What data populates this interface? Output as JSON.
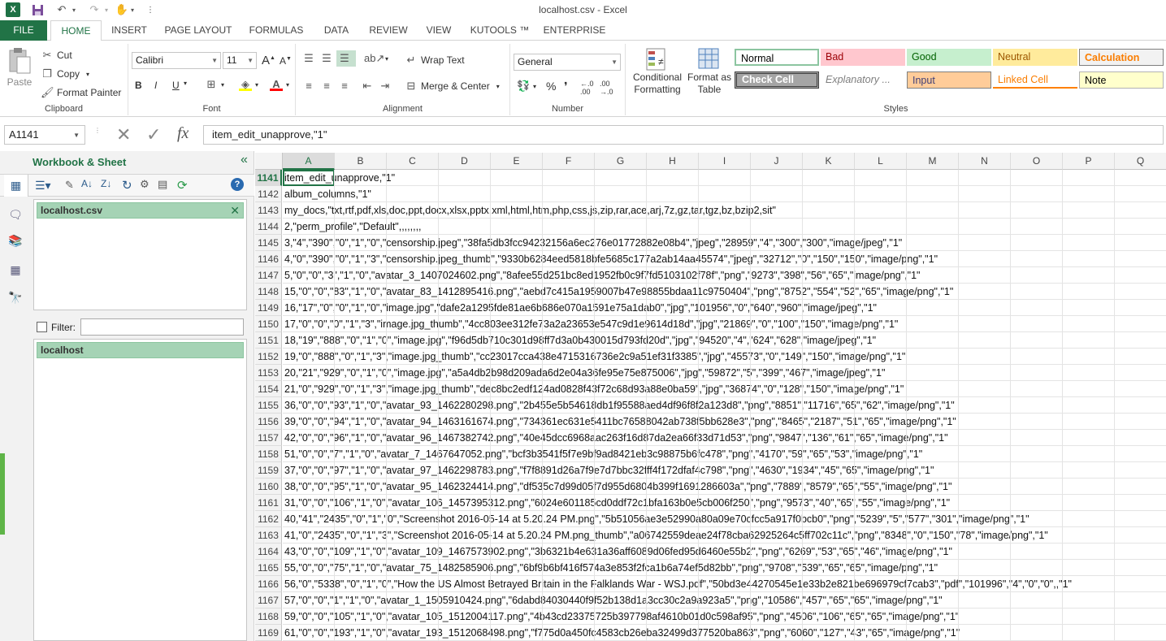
{
  "app": {
    "title": "localhost.csv - Excel",
    "logo": "X"
  },
  "tabs": [
    "FILE",
    "HOME",
    "INSERT",
    "PAGE LAYOUT",
    "FORMULAS",
    "DATA",
    "REVIEW",
    "VIEW",
    "KUTOOLS ™",
    "ENTERPRISE"
  ],
  "ribbon": {
    "clipboard": {
      "label": "Clipboard",
      "paste": "Paste",
      "cut": "Cut",
      "copy": "Copy",
      "format_painter": "Format Painter"
    },
    "font": {
      "label": "Font",
      "name": "Calibri",
      "size": "11",
      "bold": "B",
      "italic": "I",
      "underline": "U",
      "font_color": "A"
    },
    "alignment": {
      "label": "Alignment",
      "wrap_text": "Wrap Text",
      "merge_center": "Merge & Center"
    },
    "number": {
      "label": "Number",
      "format": "General",
      "percent": "%"
    },
    "styles": {
      "label": "Styles",
      "conditional_formatting": [
        "Conditional",
        "Formatting"
      ],
      "format_as_table": [
        "Format as",
        "Table"
      ],
      "cells": [
        {
          "name": "Normal",
          "bg": "#ffffff",
          "fg": "#000000"
        },
        {
          "name": "Bad",
          "bg": "#ffc7ce",
          "fg": "#9c0006"
        },
        {
          "name": "Good",
          "bg": "#c6efce",
          "fg": "#006100"
        },
        {
          "name": "Neutral",
          "bg": "#ffeb9c",
          "fg": "#9c5700"
        },
        {
          "name": "Calculation",
          "bg": "#f2f2f2",
          "fg": "#fa7d00"
        },
        {
          "name": "Check Cell",
          "bg": "#a5a5a5",
          "fg": "#ffffff"
        },
        {
          "name": "Explanatory ...",
          "bg": "#ffffff",
          "fg": "#7f7f7f"
        },
        {
          "name": "Input",
          "bg": "#ffcc99",
          "fg": "#3f3f76"
        },
        {
          "name": "Linked Cell",
          "bg": "#ffffff",
          "fg": "#fa7d00"
        },
        {
          "name": "Note",
          "bg": "#ffffcc",
          "fg": "#000000"
        }
      ]
    }
  },
  "formula_bar": {
    "name_box": "A1141",
    "fx": "fx",
    "value": "item_edit_unapprove,\"1\""
  },
  "side_pane": {
    "title": "Workbook & Sheet",
    "collapse": "«",
    "help": "?",
    "workbook": "localhost.csv",
    "filter_label": "Filter:",
    "sheet": "localhost"
  },
  "grid": {
    "columns": [
      "A",
      "B",
      "C",
      "D",
      "E",
      "F",
      "G",
      "H",
      "I",
      "J",
      "K",
      "L",
      "M",
      "N",
      "O",
      "P",
      "Q"
    ],
    "selected_column": "A",
    "selected_row": "1141",
    "rows": [
      {
        "n": "1141",
        "text": "item_edit_unapprove,\"1\""
      },
      {
        "n": "1142",
        "text": "album_columns,\"1\""
      },
      {
        "n": "1143",
        "text": "my_docs,\"txt,rtf,pdf,xls,doc,ppt,docx,xlsx,pptx,xml,html,htm,php,css,js,zip,rar,ace,arj,7z,gz,tar,tgz,bz,bzip2,sit\""
      },
      {
        "n": "1144",
        "text": "2,\"perm_profile\",\"Default\",,,,,,,,"
      },
      {
        "n": "1145",
        "text": "3,\"4\",\"390\",\"0\",\"1\",\"0\",\"censorship.jpeg\",\"38fa5db3fcc94232156a6ec276e01772882e08b4\",\"jpeg\",\"28959\",\"4\",\"300\",\"300\",\"image/jpeg\",\"1\""
      },
      {
        "n": "1146",
        "text": "4,\"0\",\"390\",\"0\",\"1\",\"3\",\"censorship.jpeg_thumb\",\"9330b6284eed5818bfe5685c177a2ab14aa45574\",\"jpeg\",\"32712\",\"0\",\"150\",\"150\",\"image/png\",\"1\""
      },
      {
        "n": "1147",
        "text": "5,\"0\",\"0\",\"3\",\"1\",\"0\",\"avatar_3_1407024602.png\",\"8afee55d251bc8ed1952fb0c9f7fd5103102f78f\",\"png\",\"9273\",\"398\",\"56\",\"65\",\"image/png\",\"1\""
      },
      {
        "n": "1148",
        "text": "15,\"0\",\"0\",\"83\",\"1\",\"0\",\"avatar_83_1412895416.png\",\"aebd7c415a1959007b47e98855bdaa11c9750404\",\"png\",\"8752\",\"554\",\"52\",\"65\",\"image/png\",\"1\""
      },
      {
        "n": "1149",
        "text": "16,\"17\",\"0\",\"0\",\"1\",\"0\",\"image.jpg\",\"dafe2a1295fde81ae6b686e070a1591e75a1dab0\",\"jpg\",\"101956\",\"0\",\"640\",\"960\",\"image/jpeg\",\"1\""
      },
      {
        "n": "1150",
        "text": "17,\"0\",\"0\",\"0\",\"1\",\"3\",\"image.jpg_thumb\",\"4cc803ee312fe73a2a23653e547c9d1e9614d18d\",\"jpg\",\"21869\",\"0\",\"100\",\"150\",\"image/png\",\"1\""
      },
      {
        "n": "1151",
        "text": "18,\"19\",\"888\",\"0\",\"1\",\"0\",\"image.jpg\",\"f96d5db710c301d98ff7d3a0b430015d793fd20d\",\"jpg\",\"94520\",\"4\",\"624\",\"628\",\"image/jpeg\",\"1\""
      },
      {
        "n": "1152",
        "text": "19,\"0\",\"888\",\"0\",\"1\",\"3\",\"image.jpg_thumb\",\"cc23017cca438e4715316736e2c9a51ef31f3385\",\"jpg\",\"45573\",\"0\",\"149\",\"150\",\"image/png\",\"1\""
      },
      {
        "n": "1153",
        "text": "20,\"21\",\"929\",\"0\",\"1\",\"0\",\"image.jpg\",\"a5a4db2b98d209ada6d2e04a36fe95e75e875006\",\"jpg\",\"59872\",\"5\",\"399\",\"467\",\"image/jpeg\",\"1\""
      },
      {
        "n": "1154",
        "text": "21,\"0\",\"929\",\"0\",\"1\",\"3\",\"image.jpg_thumb\",\"dec8bc2edf124ad0828f43f72c68d93a88e0ba59\",\"jpg\",\"36874\",\"0\",\"128\",\"150\",\"image/png\",\"1\""
      },
      {
        "n": "1155",
        "text": "36,\"0\",\"0\",\"93\",\"1\",\"0\",\"avatar_93_1462280298.png\",\"2b455e5b54618db1f95588aed4df96f8f2a123d8\",\"png\",\"8851\",\"11716\",\"65\",\"62\",\"image/png\",\"1\""
      },
      {
        "n": "1156",
        "text": "39,\"0\",\"0\",\"94\",\"1\",\"0\",\"avatar_94_1463161674.png\",\"734361ec631e5411bc76588042ab738f5bb628e3\",\"png\",\"8465\",\"2187\",\"51\",\"65\",\"image/png\",\"1\""
      },
      {
        "n": "1157",
        "text": "42,\"0\",\"0\",\"96\",\"1\",\"0\",\"avatar_96_1467382742.png\",\"40e45dcc6968aac263f16d87da2ea66f33d71d53\",\"png\",\"9847\",\"136\",\"61\",\"65\",\"image/png\",\"1\""
      },
      {
        "n": "1158",
        "text": "51,\"0\",\"0\",\"7\",\"1\",\"0\",\"avatar_7_1467647052.png\",\"bcf3b3541f5f7e9bf9ad8421eb3c98875b6fc478\",\"png\",\"4170\",\"59\",\"65\",\"53\",\"image/png\",\"1\""
      },
      {
        "n": "1159",
        "text": "37,\"0\",\"0\",\"97\",\"1\",\"0\",\"avatar_97_1462298783.png\",\"f7f8891d26a7f9e7d7bbc32fff4f172dfaf4c798\",\"png\",\"4630\",\"1934\",\"45\",\"65\",\"image/png\",\"1\""
      },
      {
        "n": "1160",
        "text": "38,\"0\",\"0\",\"95\",\"1\",\"0\",\"avatar_95_1462324414.png\",\"df535c7d99d05f7d955d6804b399f1691286603a\",\"png\",\"7889\",\"8579\",\"65\",\"55\",\"image/png\",\"1\""
      },
      {
        "n": "1161",
        "text": "31,\"0\",\"0\",\"106\",\"1\",\"0\",\"avatar_106_1457395312.png\",\"6024e601185cd0ddf72c1bfa163b0e5cb006f250\",\"png\",\"9573\",\"40\",\"65\",\"55\",\"image/png\",\"1\""
      },
      {
        "n": "1162",
        "text": "40,\"41\",\"2435\",\"0\",\"1\",\"0\",\"Screenshot 2016-05-14 at 5.20.24 PM.png\",\"5b51056ae3e52990a80a09e70cfcc5a917f0bcb0\",\"png\",\"5239\",\"5\",\"577\",\"301\",\"image/png\",\"1\""
      },
      {
        "n": "1163",
        "text": "41,\"0\",\"2435\",\"0\",\"1\",\"3\",\"Screenshot 2016-05-14 at 5.20.24 PM.png_thumb\",\"a06742559deae24f78cba62925264c5ff702c11c\",\"png\",\"8348\",\"0\",\"150\",\"78\",\"image/png\",\"1\""
      },
      {
        "n": "1164",
        "text": "43,\"0\",\"0\",\"109\",\"1\",\"0\",\"avatar_109_1467573902.png\",\"3b6321b4e631a36aff6089d06fed95d6460e55b2\",\"png\",\"6269\",\"53\",\"65\",\"46\",\"image/png\",\"1\""
      },
      {
        "n": "1165",
        "text": "55,\"0\",\"0\",\"75\",\"1\",\"0\",\"avatar_75_1482585906.png\",\"6bf9b6bf416f574a3e853f2fca1b6a74ef5d82bb\",\"png\",\"9708\",\"539\",\"65\",\"65\",\"image/png\",\"1\""
      },
      {
        "n": "1166",
        "text": "56,\"0\",\"5338\",\"0\",\"1\",\"0\",\"How the US Almost Betrayed Britain in the Falklands War - WSJ.pdf\",\"50bd3e44270545e1e33b2e821be696979cf7cab3\",\"pdf\",\"101996\",\"4\",\"0\",\"0\",,\"1\""
      },
      {
        "n": "1167",
        "text": "57,\"0\",\"0\",\"1\",\"1\",\"0\",\"avatar_1_1505910424.png\",\"6dabd84030440f9f52b138d1a3cc30c2a9a923a5\",\"png\",\"10586\",\"457\",\"65\",\"65\",\"image/png\",\"1\""
      },
      {
        "n": "1168",
        "text": "59,\"0\",\"0\",\"105\",\"1\",\"0\",\"avatar_105_1512004117.png\",\"4b43cd23375725b397798af4610b01d0c598af95\",\"png\",\"4506\",\"106\",\"65\",\"65\",\"image/png\",\"1\""
      },
      {
        "n": "1169",
        "text": "61,\"0\",\"0\",\"193\",\"1\",\"0\",\"avatar_193_1512068498.png\",\"f775d0a450fc4583cb26eba32499d377520ba863\",\"png\",\"6060\",\"127\",\"43\",\"65\",\"image/png\",\"1\""
      }
    ]
  }
}
